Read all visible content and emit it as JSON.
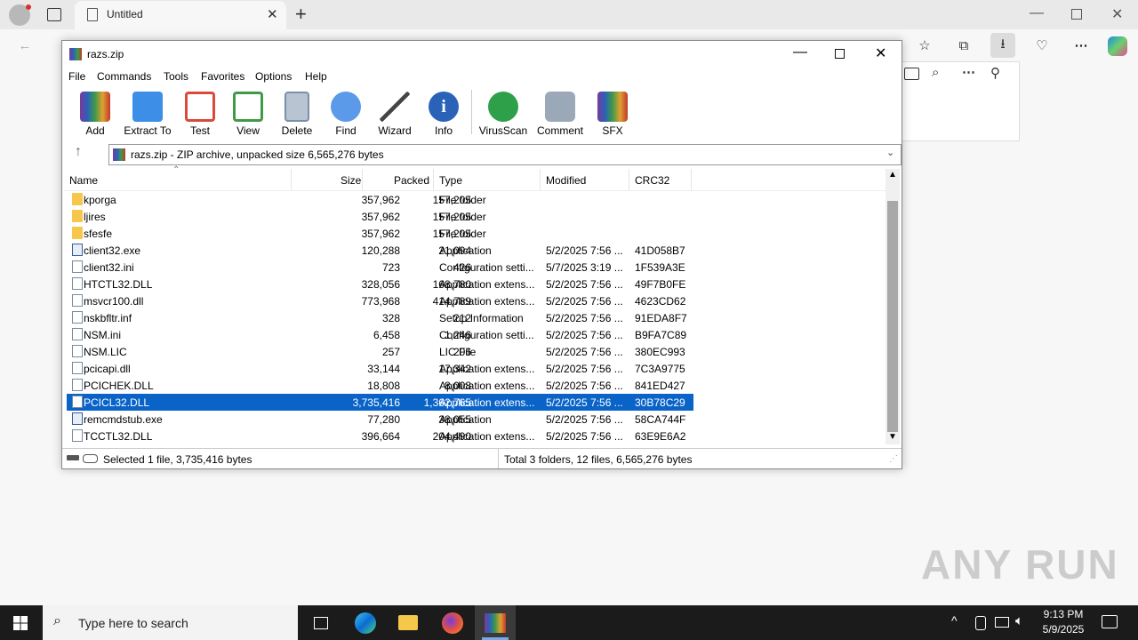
{
  "browser": {
    "tab_title": "Untitled",
    "new_tab_symbol": "+"
  },
  "winrar": {
    "title": "razs.zip",
    "menu": [
      "File",
      "Commands",
      "Tools",
      "Favorites",
      "Options",
      "Help"
    ],
    "toolbar": [
      {
        "label": "Add",
        "color": "#c03a2b"
      },
      {
        "label": "Extract To",
        "color": "#3c8ee6"
      },
      {
        "label": "Test",
        "color": "#d94a3a"
      },
      {
        "label": "View",
        "color": "#3f9a48"
      },
      {
        "label": "Delete",
        "color": "#7a8fa8"
      },
      {
        "label": "Find",
        "color": "#2f6fd0"
      },
      {
        "label": "Wizard",
        "color": "#5aa0d8"
      },
      {
        "label": "Info",
        "color": "#2a62b8"
      },
      {
        "label": "VirusScan",
        "color": "#2ea04a"
      },
      {
        "label": "Comment",
        "color": "#7a8a9c"
      },
      {
        "label": "SFX",
        "color": "#d8a04a"
      }
    ],
    "path_text": "razs.zip - ZIP archive, unpacked size 6,565,276 bytes",
    "columns": [
      "Name",
      "Size",
      "Packed",
      "Type",
      "Modified",
      "CRC32"
    ],
    "rows": [
      {
        "name": "kporga",
        "size": "357,962",
        "packed": "157,205",
        "type": "File folder",
        "modified": "",
        "crc": "",
        "icon": "folder"
      },
      {
        "name": "ljires",
        "size": "357,962",
        "packed": "157,205",
        "type": "File folder",
        "modified": "",
        "crc": "",
        "icon": "folder"
      },
      {
        "name": "sfesfe",
        "size": "357,962",
        "packed": "157,205",
        "type": "File folder",
        "modified": "",
        "crc": "",
        "icon": "folder"
      },
      {
        "name": "client32.exe",
        "size": "120,288",
        "packed": "21,094",
        "type": "Application",
        "modified": "5/2/2025 7:56 ...",
        "crc": "41D058B7",
        "icon": "exe"
      },
      {
        "name": "client32.ini",
        "size": "723",
        "packed": "426",
        "type": "Configuration setti...",
        "modified": "5/7/2025 3:19 ...",
        "crc": "1F539A3E",
        "icon": "doc"
      },
      {
        "name": "HTCTL32.DLL",
        "size": "328,056",
        "packed": "168,780",
        "type": "Application extens...",
        "modified": "5/2/2025 7:56 ...",
        "crc": "49F7B0FE",
        "icon": "doc"
      },
      {
        "name": "msvcr100.dll",
        "size": "773,968",
        "packed": "414,789",
        "type": "Application extens...",
        "modified": "5/2/2025 7:56 ...",
        "crc": "4623CD62",
        "icon": "doc"
      },
      {
        "name": "nskbfltr.inf",
        "size": "328",
        "packed": "212",
        "type": "Setup Information",
        "modified": "5/2/2025 7:56 ...",
        "crc": "91EDA8F7",
        "icon": "doc"
      },
      {
        "name": "NSM.ini",
        "size": "6,458",
        "packed": "1,246",
        "type": "Configuration setti...",
        "modified": "5/2/2025 7:56 ...",
        "crc": "B9FA7C89",
        "icon": "doc"
      },
      {
        "name": "NSM.LIC",
        "size": "257",
        "packed": "206",
        "type": "LIC File",
        "modified": "5/2/2025 7:56 ...",
        "crc": "380EC993",
        "icon": "doc"
      },
      {
        "name": "pcicapi.dll",
        "size": "33,144",
        "packed": "17,342",
        "type": "Application extens...",
        "modified": "5/2/2025 7:56 ...",
        "crc": "7C3A9775",
        "icon": "doc"
      },
      {
        "name": "PCICHEK.DLL",
        "size": "18,808",
        "packed": "8,008",
        "type": "Application extens...",
        "modified": "5/2/2025 7:56 ...",
        "crc": "841ED427",
        "icon": "doc"
      },
      {
        "name": "PCICL32.DLL",
        "size": "3,735,416",
        "packed": "1,362,765",
        "type": "Application extens...",
        "modified": "5/2/2025 7:56 ...",
        "crc": "30B78C29",
        "icon": "doc",
        "selected": true
      },
      {
        "name": "remcmdstub.exe",
        "size": "77,280",
        "packed": "38,055",
        "type": "Application",
        "modified": "5/2/2025 7:56 ...",
        "crc": "58CA744F",
        "icon": "exe"
      },
      {
        "name": "TCCTL32.DLL",
        "size": "396,664",
        "packed": "204,490",
        "type": "Application extens...",
        "modified": "5/2/2025 7:56 ...",
        "crc": "63E9E6A2",
        "icon": "doc"
      }
    ],
    "status_left": "Selected 1 file, 3,735,416 bytes",
    "status_right": "Total 3 folders, 12 files, 6,565,276 bytes"
  },
  "taskbar": {
    "search_placeholder": "Type here to search",
    "time": "9:13 PM",
    "date": "5/9/2025"
  },
  "watermark": "ANY RUN"
}
